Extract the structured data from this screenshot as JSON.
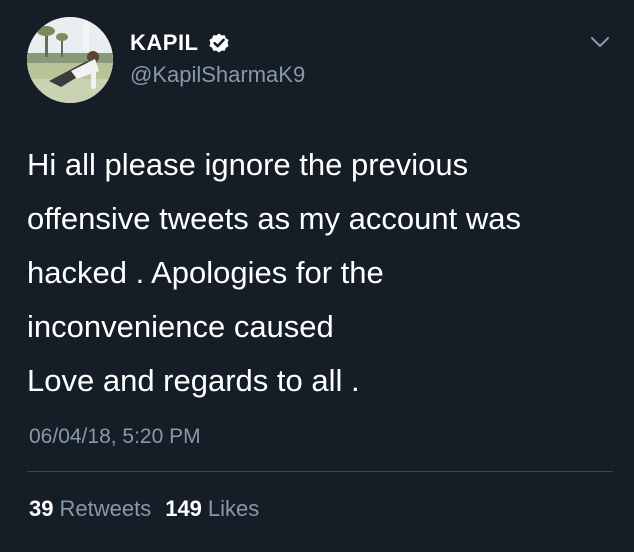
{
  "user": {
    "display_name": "KAPIL",
    "handle": "@KapilSharmaK9",
    "verified": true
  },
  "tweet": {
    "lines": [
      "Hi all please ignore the previous",
      "offensive tweets as my account was",
      "hacked . Apologies for the",
      "inconvenience caused",
      "Love and regards to all ."
    ],
    "timestamp": "06/04/18, 5:20 PM"
  },
  "stats": {
    "retweets_count": "39",
    "retweets_label": "Retweets",
    "likes_count": "149",
    "likes_label": "Likes"
  },
  "icons": {
    "verified": "verified-badge-icon",
    "menu": "chevron-down-icon"
  },
  "colors": {
    "background": "#151d26",
    "text": "#ffffff",
    "secondary_text": "#8899a6",
    "divider": "#38444d"
  }
}
